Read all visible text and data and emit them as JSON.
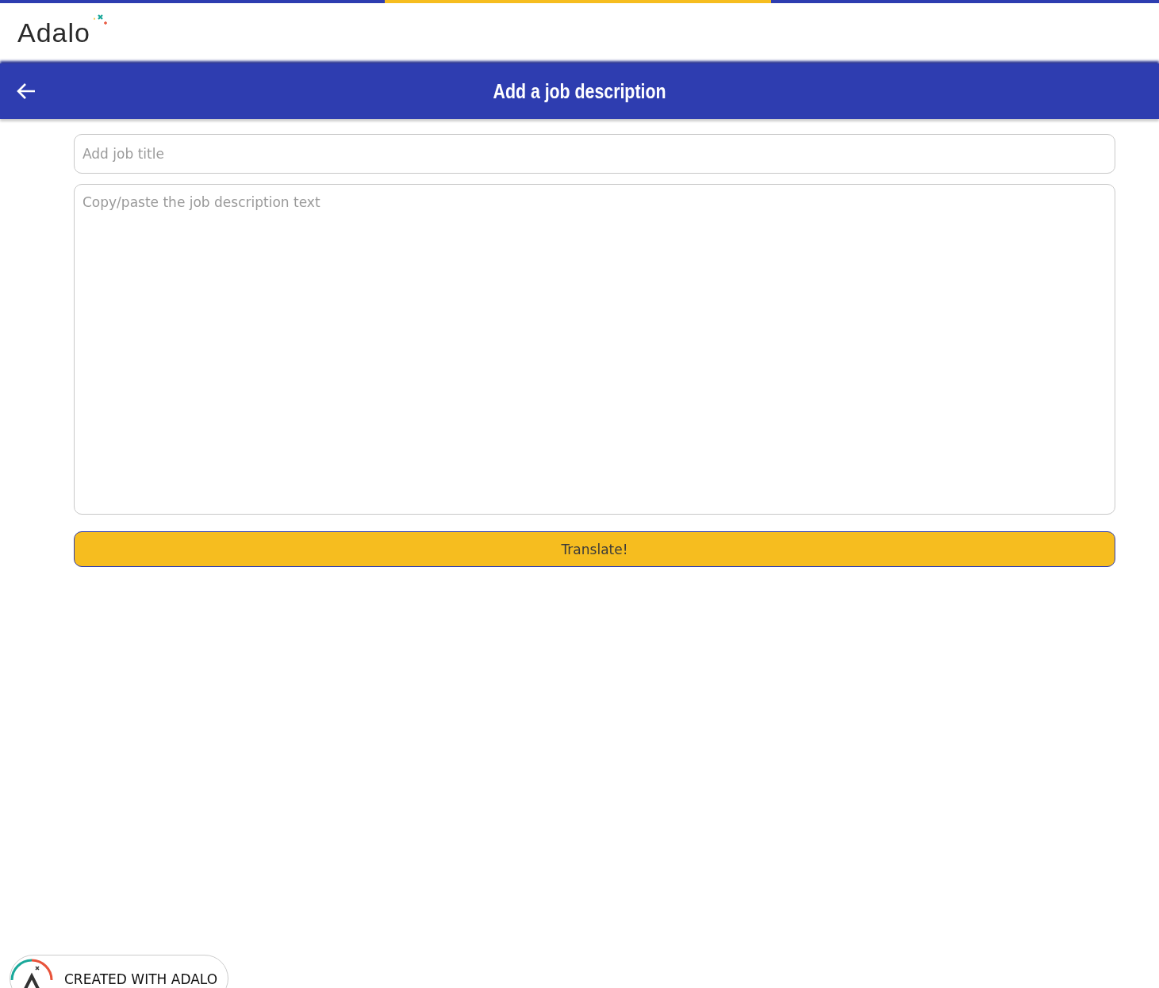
{
  "logo": {
    "text": "Adalo"
  },
  "app_bar": {
    "title": "Add a job description"
  },
  "form": {
    "title_field": {
      "placeholder": "Add job title"
    },
    "description_field": {
      "placeholder": "Copy/paste the job description text"
    },
    "submit_button": "Translate!"
  },
  "badge": {
    "text": "CREATED WITH ADALO"
  }
}
